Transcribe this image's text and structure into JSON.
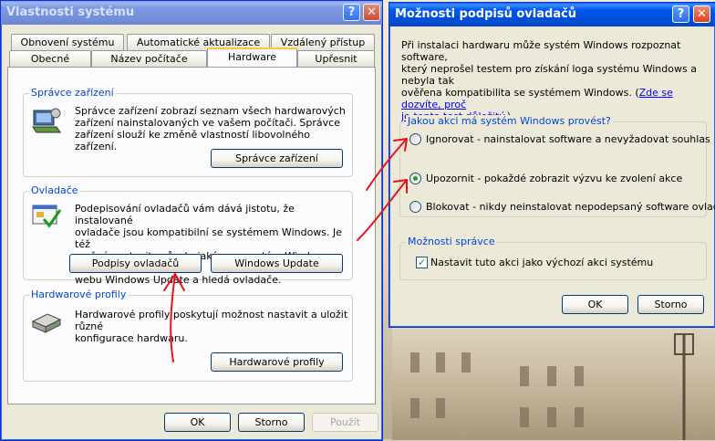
{
  "system_properties": {
    "title": "Vlastnosti systému",
    "tabs_row1": [
      "Obnovení systému",
      "Automatické aktualizace",
      "Vzdálený přístup"
    ],
    "tabs_row2": [
      "Obecné",
      "Název počítače",
      "Hardware",
      "Upřesnit"
    ],
    "active_tab": "Hardware",
    "device_manager": {
      "label": "Správce zařízení",
      "text": [
        "Správce zařízení zobrazí seznam všech hardwarových",
        "zařízení nainstalovaných ve vašem počítači. Správce",
        "zařízení slouží ke změně vlastností libovolného zařízení."
      ],
      "button": "Správce zařízení"
    },
    "drivers": {
      "label": "Ovladače",
      "text": [
        "Podepisování ovladačů vám dává jistotu, že instalované",
        "ovladače jsou kompatibilní se systémem Windows. Je též",
        "možné nastavit způsob, jakým se systém Windows připojuje k",
        "webu Windows Update a hledá ovladače."
      ],
      "button_signing": "Podpisy ovladačů",
      "button_update": "Windows Update"
    },
    "hardware_profiles": {
      "label": "Hardwarové profily",
      "text": [
        "Hardwarové profily poskytují možnost nastavit a uložit různé",
        "konfigurace hardwaru."
      ],
      "button": "Hardwarové profily"
    },
    "buttons": {
      "ok": "OK",
      "cancel": "Storno",
      "apply": "Použít"
    }
  },
  "driver_signing": {
    "title": "Možnosti podpisů ovladačů",
    "intro": [
      "Při instalaci hardwaru může systém Windows rozpoznat software,",
      "který neprošel testem pro získání loga systému Windows a nebyla tak",
      "ověřena kompatibilita se systémem Windows. ("
    ],
    "intro_link1": "Zde se dozvíte, proč",
    "intro_link2": "je tento test důležitý",
    "intro_link_suffix": ".)",
    "action_group": {
      "label": "Jakou akci má systém Windows provést?",
      "options": [
        {
          "label": "Ignorovat - nainstalovat software a nevyžadovat souhlas",
          "selected": false
        },
        {
          "label": "Upozornit - pokaždé zobrazit výzvu ke zvolení akce",
          "selected": true
        },
        {
          "label": "Blokovat - nikdy neinstalovat nepodepsaný software ovladače",
          "selected": false
        }
      ]
    },
    "admin_group": {
      "label": "Možnosti správce",
      "checkbox_label": "Nastavit tuto akci jako výchozí akci systému",
      "checked": true
    },
    "buttons": {
      "ok": "OK",
      "cancel": "Storno"
    }
  },
  "colors": {
    "arrow": "#e8121a",
    "group_label": "#0046d5",
    "title_active": "#0054e3"
  }
}
